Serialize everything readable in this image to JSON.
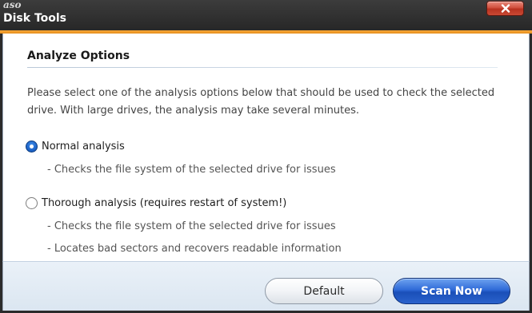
{
  "window": {
    "brand": "aso",
    "title": "Disk Tools",
    "close_icon": "close-x-icon",
    "accent_color": "#f0a02a"
  },
  "section": {
    "title": "Analyze Options",
    "description": "Please select one of the analysis options below that should be used to check the selected drive. With large drives, the analysis may take several minutes."
  },
  "options": [
    {
      "label": "Normal analysis",
      "selected": true,
      "details": [
        "- Checks the file system of the selected drive for issues"
      ]
    },
    {
      "label": "Thorough analysis (requires restart of system!)",
      "selected": false,
      "details": [
        "- Checks the file system of the selected drive for issues",
        "- Locates bad sectors and recovers readable information"
      ]
    }
  ],
  "buttons": {
    "default_label": "Default",
    "scan_label": "Scan Now"
  }
}
